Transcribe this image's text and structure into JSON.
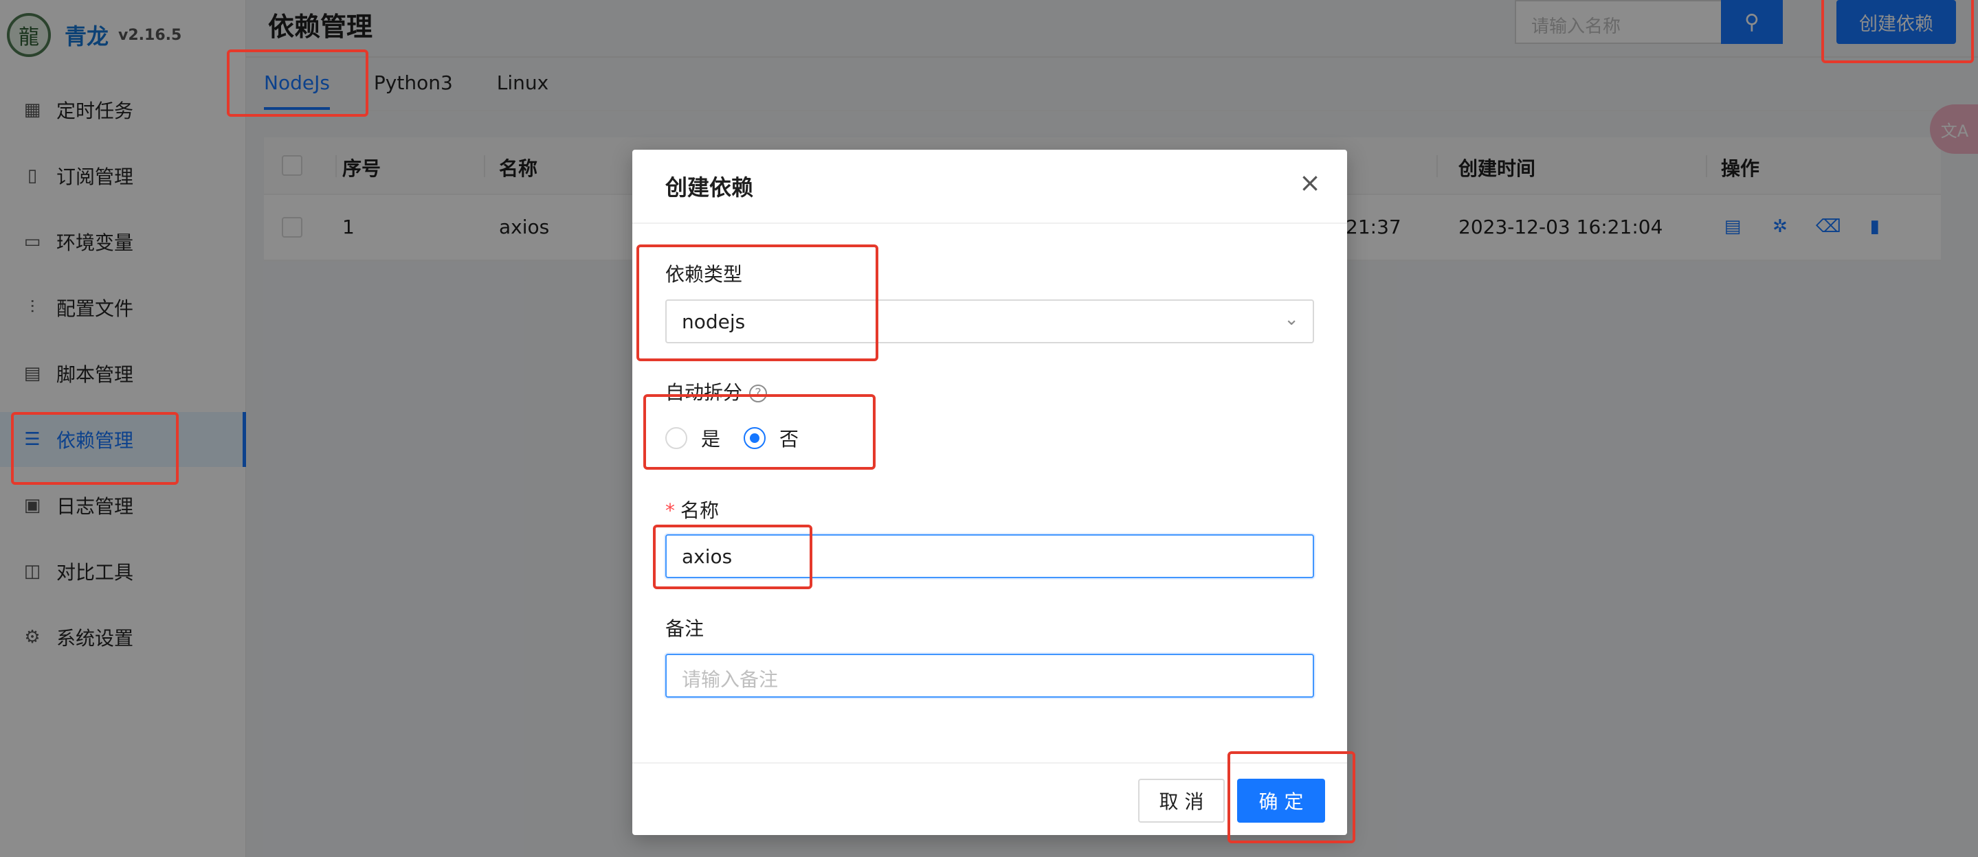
{
  "app": {
    "name": "青龙",
    "version": "v2.16.5"
  },
  "sidebar": {
    "items": [
      {
        "label": "定时任务",
        "icon": "calendar-clock-icon"
      },
      {
        "label": "订阅管理",
        "icon": "subscribe-icon"
      },
      {
        "label": "环境变量",
        "icon": "monitor-icon"
      },
      {
        "label": "配置文件",
        "icon": "sliders-icon"
      },
      {
        "label": "脚本管理",
        "icon": "code-file-icon"
      },
      {
        "label": "依赖管理",
        "icon": "list-circle-icon",
        "active": true
      },
      {
        "label": "日志管理",
        "icon": "log-icon"
      },
      {
        "label": "对比工具",
        "icon": "diff-icon"
      },
      {
        "label": "系统设置",
        "icon": "gear-icon"
      }
    ]
  },
  "header": {
    "title": "依赖管理",
    "search_placeholder": "请输入名称",
    "search_icon": "search-icon",
    "create_label": "创建依赖"
  },
  "tabs": [
    {
      "label": "NodeJs",
      "active": true
    },
    {
      "label": "Python3"
    },
    {
      "label": "Linux"
    }
  ],
  "table": {
    "columns": [
      "序号",
      "名称",
      "创建时间",
      "操作"
    ],
    "rows": [
      {
        "index": "1",
        "name": "axios",
        "updated_time_partial": "21:37",
        "created_time": "2023-12-03 16:21:04"
      }
    ],
    "action_icons": [
      "file-icon",
      "bug-icon",
      "trash-icon",
      "trash-filled-icon"
    ]
  },
  "modal": {
    "title": "创建依赖",
    "close_icon": "close-icon",
    "type_label": "依赖类型",
    "type_value": "nodejs",
    "split_label": "自动拆分",
    "split_options": [
      "是",
      "否"
    ],
    "split_selected": "否",
    "name_label": "名称",
    "name_required_mark": "*",
    "name_value": "axios",
    "remark_label": "备注",
    "remark_placeholder": "请输入备注",
    "cancel_label": "取 消",
    "ok_label": "确 定"
  },
  "colors": {
    "primary": "#1677ff",
    "annotation": "#e5392b",
    "required": "#ff4d4f"
  }
}
